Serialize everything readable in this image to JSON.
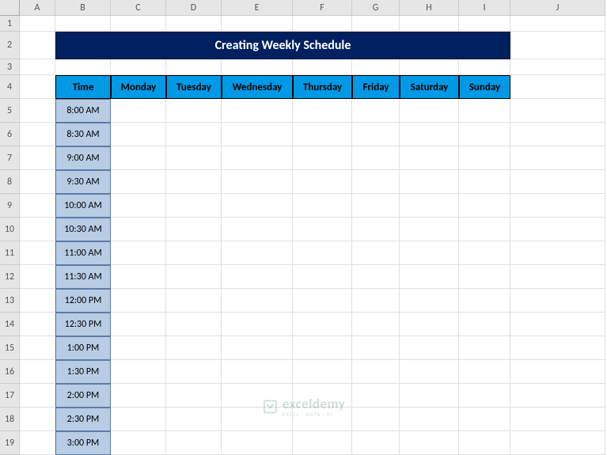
{
  "columns": [
    "A",
    "B",
    "C",
    "D",
    "E",
    "F",
    "G",
    "H",
    "I",
    "J"
  ],
  "rows": [
    "1",
    "2",
    "3",
    "4",
    "5",
    "6",
    "7",
    "8",
    "9",
    "10",
    "11",
    "12",
    "13",
    "14",
    "15",
    "16",
    "17",
    "18",
    "19"
  ],
  "title": "Creating Weekly Schedule",
  "headers": {
    "time": "Time",
    "days": [
      "Monday",
      "Tuesday",
      "Wednesday",
      "Thursday",
      "Friday",
      "Saturday",
      "Sunday"
    ]
  },
  "times": [
    "8:00 AM",
    "8:30 AM",
    "9:00 AM",
    "9:30 AM",
    "10:00 AM",
    "10:30 AM",
    "11:00 AM",
    "11:30 AM",
    "12:00 PM",
    "12:30 PM",
    "1:00 PM",
    "1:30 PM",
    "2:00 PM",
    "2:30 PM",
    "3:00 PM"
  ],
  "watermark": {
    "name": "exceldemy",
    "sub": "EXCEL · DATA · BI"
  },
  "colors": {
    "titlebg": "#002060",
    "headerbg": "#0099e5",
    "timebg": "#b8cce4"
  }
}
